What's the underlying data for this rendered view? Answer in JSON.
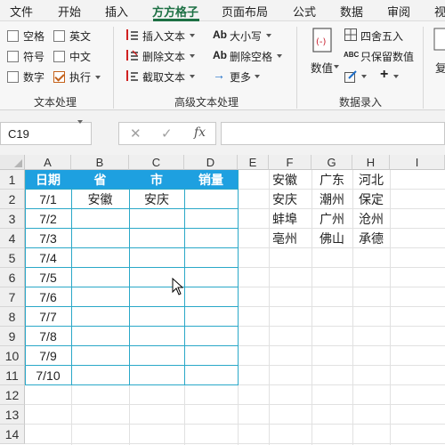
{
  "menu": {
    "tabs": [
      "文件",
      "开始",
      "插入",
      "方方格子",
      "页面布局",
      "公式",
      "数据",
      "审阅",
      "视"
    ],
    "active_tab": "方方格子"
  },
  "ribbon": {
    "text_processing": {
      "checkboxes": [
        {
          "label": "空格",
          "checked": false
        },
        {
          "label": "英文",
          "checked": false
        },
        {
          "label": "符号",
          "checked": false
        },
        {
          "label": "中文",
          "checked": false
        },
        {
          "label": "数字",
          "checked": false
        },
        {
          "label": "执行",
          "checked": true
        }
      ],
      "group_label": "文本处理"
    },
    "advanced_text": {
      "buttons": [
        "插入文本",
        "删除文本",
        "截取文本",
        "大小写",
        "删除空格",
        "更多"
      ],
      "group_label": "高级文本处理"
    },
    "data_entry": {
      "value_button": "数值",
      "round_button": "四舍五入",
      "keep_value_button": "只保留数值",
      "group_label": "数据录入"
    },
    "cut_label": "复"
  },
  "formula_bar": {
    "name_box": "C19",
    "cancel_symbol": "✕",
    "confirm_symbol": "✓",
    "fx_label": "fx",
    "formula": ""
  },
  "sheet": {
    "columns": [
      "A",
      "B",
      "C",
      "D",
      "E",
      "F",
      "G",
      "H",
      "I"
    ],
    "rows": [
      "1",
      "2",
      "3",
      "4",
      "5",
      "6",
      "7",
      "8",
      "9",
      "10",
      "11",
      "12",
      "13",
      "14"
    ],
    "table_headers": [
      "日期",
      "省",
      "市",
      "销量"
    ],
    "dates": [
      "7/1",
      "7/2",
      "7/3",
      "7/4",
      "7/5",
      "7/6",
      "7/7",
      "7/8",
      "7/9",
      "7/10"
    ],
    "row2_province": "安徽",
    "row2_city": "安庆",
    "lookup": [
      [
        "安徽",
        "广东",
        "河北"
      ],
      [
        "安庆",
        "潮州",
        "保定"
      ],
      [
        "蚌埠",
        "广州",
        "沧州"
      ],
      [
        "亳州",
        "佛山",
        "承德"
      ]
    ]
  },
  "colors": {
    "accent": "#1e7145",
    "header_fill": "#1ea0e0",
    "table_border": "#2aa8c8"
  }
}
